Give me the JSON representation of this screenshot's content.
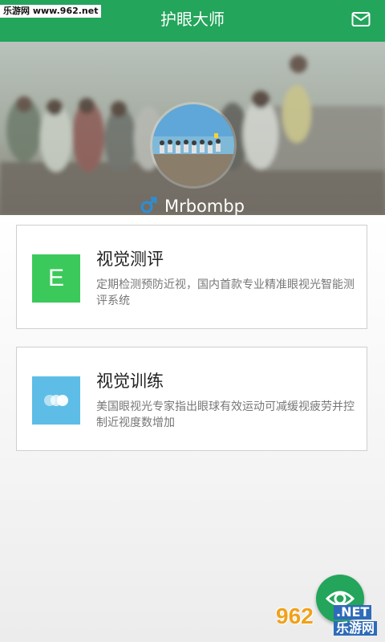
{
  "watermark_top": "乐游网 www.962.net",
  "header": {
    "title": "护眼大师",
    "mail_icon": "mail-icon",
    "color": "#23a55b"
  },
  "profile": {
    "gender_icon": "male-icon",
    "gender_color": "#2a8fd6",
    "username": "Mrbombp"
  },
  "cards": [
    {
      "icon_letter": "E",
      "icon_color": "#3cc95b",
      "title": "视觉测评",
      "description": "定期检测预防近视，国内首款专业精准眼视光智能测评系统"
    },
    {
      "icon": "dots-icon",
      "icon_color": "#5ebde6",
      "title": "视觉训练",
      "description": "美国眼视光专家指出眼球有效运动可减缓视疲劳并控制近视度数增加"
    }
  ],
  "fab_icon": "eye-icon",
  "watermark_bottom": {
    "number": "962",
    "net": ".NET",
    "cn": "乐游网"
  }
}
